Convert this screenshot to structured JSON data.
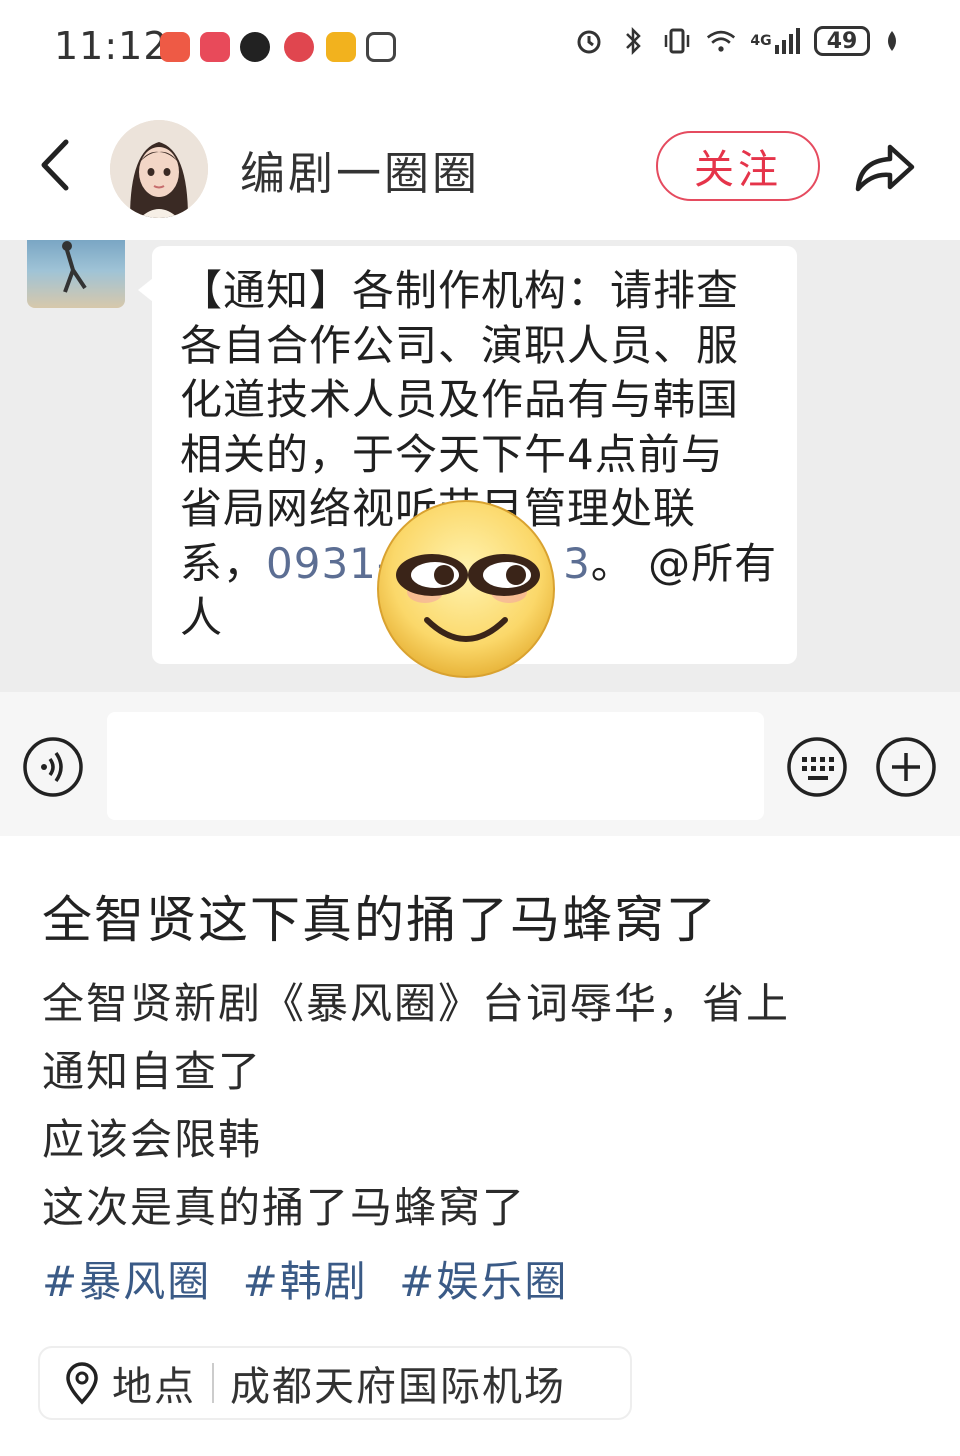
{
  "status_bar": {
    "time": "11:12",
    "network": "4G",
    "battery": "49"
  },
  "header": {
    "channel_name": "编剧一圈圈",
    "follow_label": "关注"
  },
  "chat": {
    "notice_lines": [
      "【通知】各制作机构：请排查",
      "各自合作公司、演职人员、服",
      "化道技术人员及作品有与韩国",
      "相关的，于今天下午4点前与",
      "省局网络视听节目管理处联"
    ],
    "notice_last_prefix": "系，",
    "phone_visible": "0931-",
    "phone_tail": "3",
    "notice_last_suffix": "。 @所有",
    "notice_end": "人"
  },
  "post": {
    "title": "全智贤这下真的捅了马蜂窝了",
    "body_lines": [
      "全智贤新剧《暴风圈》台词辱华，省上",
      "通知自查了",
      "应该会限韩",
      "这次是真的捅了马蜂窝了"
    ],
    "tags": [
      "#暴风圈",
      "#韩剧",
      "#娱乐圈"
    ]
  },
  "location": {
    "label": "地点",
    "value": "成都天府国际机场"
  },
  "colors": {
    "follow_accent": "#e5344a",
    "tag_color": "#3a5a86",
    "phone_link": "#5c6e93",
    "chat_background": "#ededed"
  },
  "icons": [
    "back-arrow-icon",
    "share-icon",
    "voice-icon",
    "keyboard-emoji-icon",
    "plus-icon",
    "location-pin-icon",
    "smiley-emoji-sticker"
  ]
}
